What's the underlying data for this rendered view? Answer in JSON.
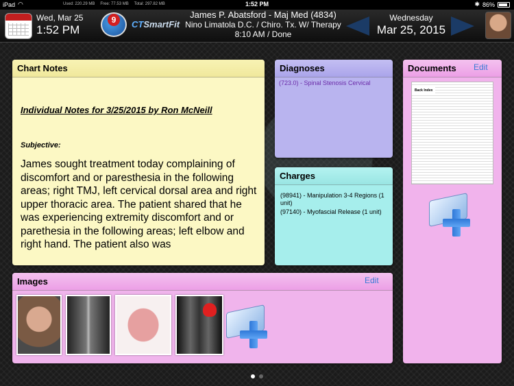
{
  "status_bar": {
    "device": "iPad",
    "time": "1:52 PM",
    "battery": "86%",
    "battery_level": 0.86,
    "mem_used": "Used: 220.29 MB",
    "mem_free": "Free: 77.53 MB",
    "mem_total": "Total: 297.82 MB"
  },
  "header": {
    "short_date": "Wed, Mar 25",
    "time": "1:52 PM",
    "badge_count": "9",
    "app_name_prefix": "CT",
    "app_name_suffix": "SmartFit",
    "patient_line": "James P. Abatsford - Maj Med (4834)",
    "provider_line": "Nino Limatola D.C. / Chiro. Tx. W/ Therapy",
    "appointment_line": "8:10 AM / Done",
    "weekday": "Wednesday",
    "full_date": "Mar 25, 2015"
  },
  "chart_notes": {
    "title": "Chart Notes",
    "heading": "Individual Notes for 3/25/2015 by Ron McNeill",
    "subheading": "Subjective:",
    "text": "James sought treatment today complaining of discomfort and or paresthesia in the following areas; right TMJ, left cervical dorsal area and right upper thoracic area. The patient shared that he was experiencing extremity discomfort and or parethesia in the following areas; left elbow and right hand. The patient also was"
  },
  "diagnoses": {
    "title": "Diagnoses",
    "items": [
      "(723.0) - Spinal Stenosis Cervical"
    ]
  },
  "charges": {
    "title": "Charges",
    "items": [
      "(98941) - Manipulation 3-4 Regions (1 unit)",
      "(97140) - Myofascial Release (1 unit)"
    ]
  },
  "documents": {
    "title": "Documents",
    "edit_label": "Edit",
    "doc_title": "Back Index"
  },
  "images": {
    "title": "Images",
    "edit_label": "Edit"
  },
  "pager": {
    "current": 1,
    "total": 2
  },
  "colors": {
    "chart_notes_bg": "#fcf8c4",
    "diagnoses_bg": "#b9b4ef",
    "charges_bg": "#a6eeec",
    "documents_bg": "#f1b3ec",
    "images_bg": "#f0b4ec",
    "link": "#3a7bd5"
  }
}
